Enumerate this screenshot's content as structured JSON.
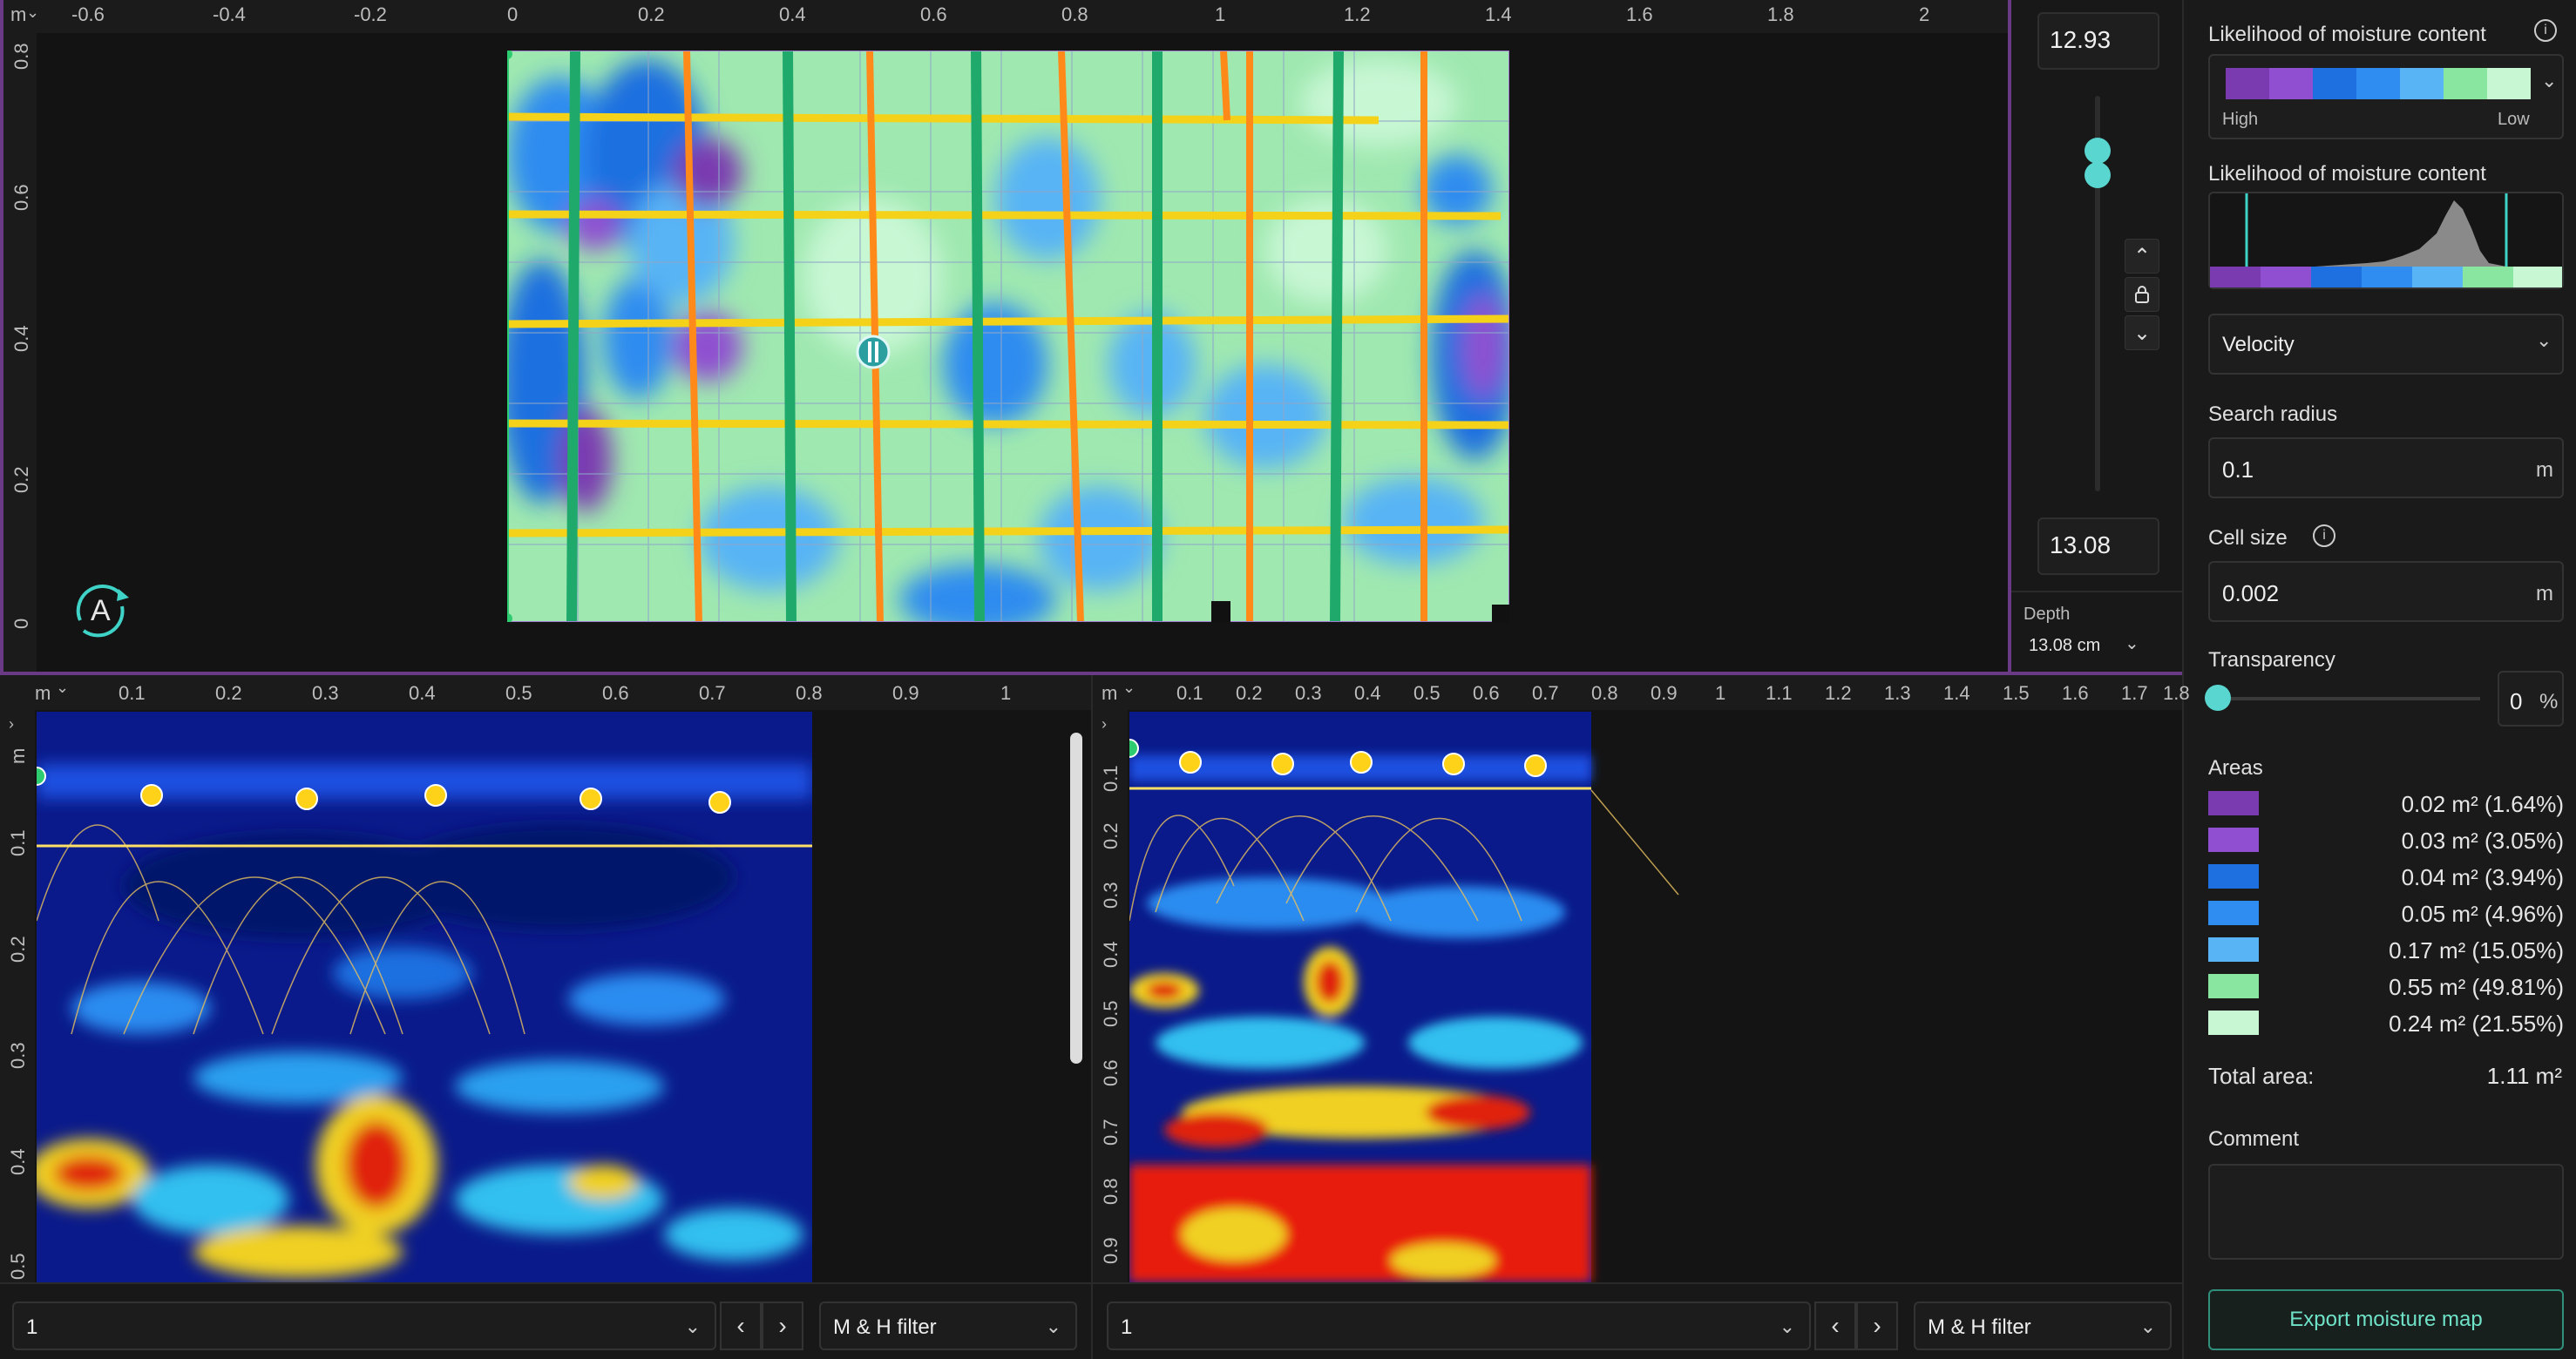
{
  "top_map": {
    "unit_label": "m",
    "x_ticks": [
      "-0.6",
      "-0.4",
      "-0.2",
      "0",
      "0.2",
      "0.4",
      "0.6",
      "0.8",
      "1",
      "1.2",
      "1.4",
      "1.6",
      "1.8",
      "2"
    ],
    "y_ticks": [
      "0.8",
      "0.6",
      "0.4",
      "0.2",
      "0"
    ],
    "compass_label": "A"
  },
  "depth_panel": {
    "top_value": "12.93",
    "bottom_value": "13.08",
    "depth_label": "Depth",
    "depth_value": "13.08 cm"
  },
  "sidebar": {
    "legend_title": "Likelihood of moisture content",
    "legend_high": "High",
    "legend_low": "Low",
    "histogram_title": "Likelihood of moisture content",
    "velocity_label": "Velocity",
    "search_radius_label": "Search radius",
    "search_radius_value": "0.1",
    "search_radius_unit": "m",
    "cell_size_label": "Cell size",
    "cell_size_value": "0.002",
    "cell_size_unit": "m",
    "transparency_label": "Transparency",
    "transparency_value": "0",
    "transparency_unit": "%",
    "areas_label": "Areas",
    "areas": [
      {
        "color": "#7a3bb0",
        "value": "0.02 m² (1.64%)"
      },
      {
        "color": "#8f4fd0",
        "value": "0.03 m² (3.05%)"
      },
      {
        "color": "#1e6fe0",
        "value": "0.04 m² (3.94%)"
      },
      {
        "color": "#2f8cf0",
        "value": "0.05 m² (4.96%)"
      },
      {
        "color": "#58b4f5",
        "value": "0.17 m² (15.05%)"
      },
      {
        "color": "#88e6a0",
        "value": "0.55 m² (49.81%)"
      },
      {
        "color": "#c8f7d4",
        "value": "0.24 m² (21.55%)"
      }
    ],
    "total_area_label": "Total area:",
    "total_area_value": "1.11 m²",
    "comment_label": "Comment",
    "export_label": "Export moisture map"
  },
  "radar_left": {
    "unit_label": "m",
    "x_ticks": [
      "0.1",
      "0.2",
      "0.3",
      "0.4",
      "0.5",
      "0.6",
      "0.7",
      "0.8",
      "0.9",
      "1"
    ],
    "y_unit": "m",
    "y_ticks": [
      "0.1",
      "0.2",
      "0.3",
      "0.4",
      "0.5"
    ],
    "line_select": "1",
    "filter_select": "M & H filter"
  },
  "radar_right": {
    "unit_label": "m",
    "x_ticks": [
      "0.1",
      "0.2",
      "0.3",
      "0.4",
      "0.5",
      "0.6",
      "0.7",
      "0.8",
      "0.9",
      "1",
      "1.1",
      "1.2",
      "1.3",
      "1.4",
      "1.5",
      "1.6",
      "1.7",
      "1.8"
    ],
    "y_ticks": [
      "0.1",
      "0.2",
      "0.3",
      "0.4",
      "0.5",
      "0.6",
      "0.7",
      "0.8",
      "0.9"
    ],
    "line_select": "1",
    "filter_select": "M & H filter"
  }
}
